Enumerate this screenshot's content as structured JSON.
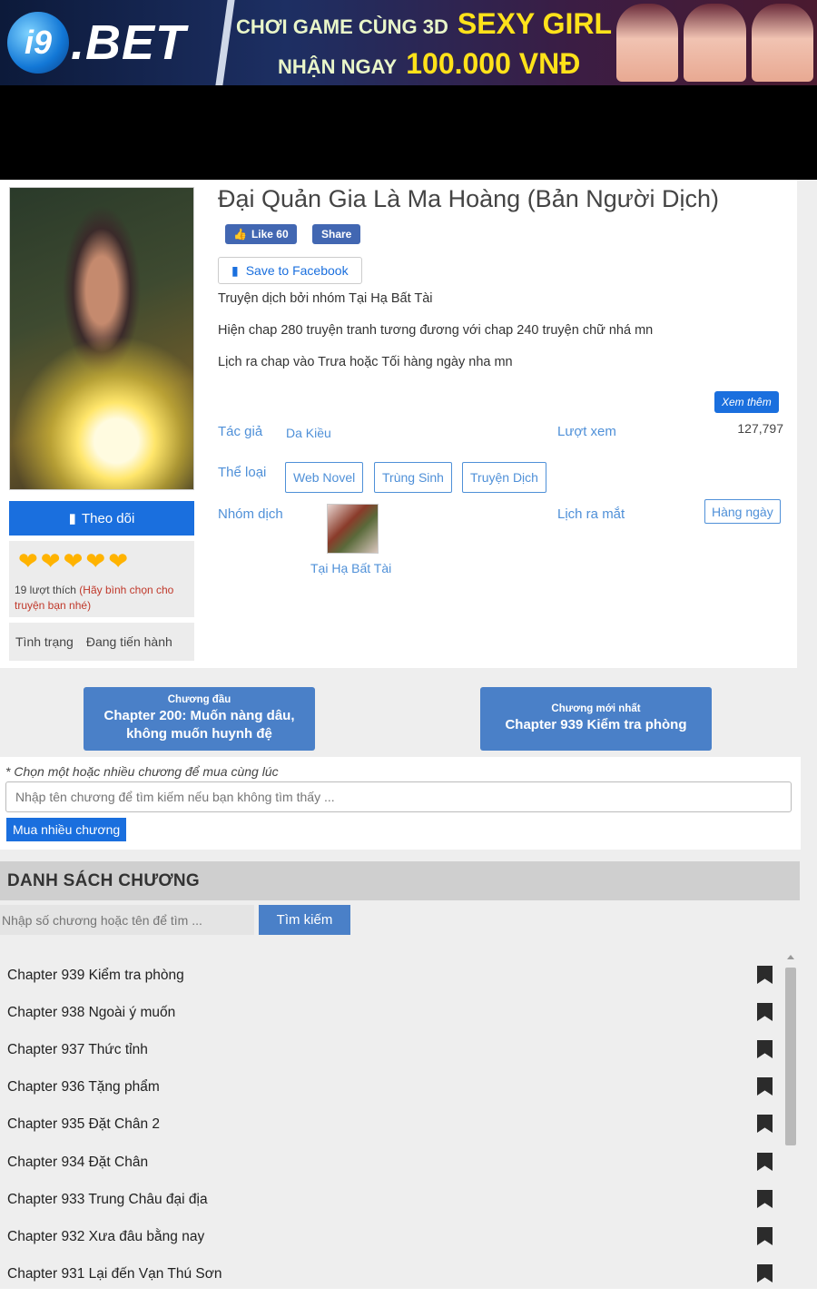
{
  "ad": {
    "logo_circle": "i9",
    "logo_rest": ".BET",
    "line1_small": "CHƠI GAME CÙNG 3D",
    "line1_big": "SEXY GIRL",
    "line2_small": "NHẬN NGAY",
    "line2_big": "100.000 VNĐ"
  },
  "story": {
    "title": "Đại Quản Gia Là Ma Hoàng (Bản Người Dịch)",
    "fb_like": "Like 60",
    "fb_share": "Share",
    "save_facebook": "Save to Facebook",
    "desc_lines": [
      "Truyện dịch bởi nhóm Tại Hạ Bất Tài",
      "Hiện chap 280 truyện tranh tương đương với chap 240 truyện chữ nhá mn",
      "Lịch ra chap vào Trưa hoặc Tối hàng ngày nha mn"
    ],
    "more_button": "Xem thêm",
    "author_label": "Tác giả",
    "author": "Da Kiều",
    "views_label": "Lượt xem",
    "views": "127,797",
    "genre_label": "Thể loại",
    "genres": [
      "Web Novel",
      "Trùng Sinh",
      "Truyện Dịch"
    ],
    "team_label": "Nhóm dịch",
    "team_name": "Tại Hạ Bất Tài",
    "schedule_label": "Lịch ra mắt",
    "schedule": "Hàng ngày"
  },
  "sidebar": {
    "follow_button": "Theo dõi",
    "hearts": 5,
    "likes_text": "19 lượt thích",
    "vote_text": "(Hãy bình chọn cho truyện bạn nhé)",
    "status_label": "Tình trạng",
    "status_value": "Đang tiến hành"
  },
  "chapter_buttons": {
    "first_small": "Chương đầu",
    "first_big": "Chapter 200: Muốn nàng dâu, không muốn huynh đệ",
    "latest_small": "Chương mới nhất",
    "latest_big": "Chapter 939 Kiểm tra phòng"
  },
  "buy": {
    "note": "* Chọn một hoặc nhiều chương để mua cùng lúc",
    "placeholder": "Nhập tên chương để tìm kiếm nếu bạn không tìm thấy ...",
    "button": "Mua nhiều chương"
  },
  "chapter_list": {
    "heading": "DANH SÁCH CHƯƠNG",
    "search_placeholder": "Nhập số chương hoặc tên để tìm ...",
    "search_button": "Tìm kiếm",
    "items": [
      "Chapter 939 Kiểm tra phòng",
      "Chapter 938 Ngoài ý muốn",
      "Chapter 937 Thức tỉnh",
      "Chapter 936 Tặng phẩm",
      "Chapter 935 Đặt Chân 2",
      "Chapter 934 Đặt Chân",
      "Chapter 933 Trung Châu đại địa",
      "Chapter 932 Xưa đâu bằng nay",
      "Chapter 931 Lại đến Vạn Thú Sơn"
    ]
  },
  "colors": {
    "primary_blue": "#1a6fde",
    "link_blue": "#4f90d8",
    "chapter_btn_blue": "#4a80c8",
    "heart": "#ffb300"
  }
}
